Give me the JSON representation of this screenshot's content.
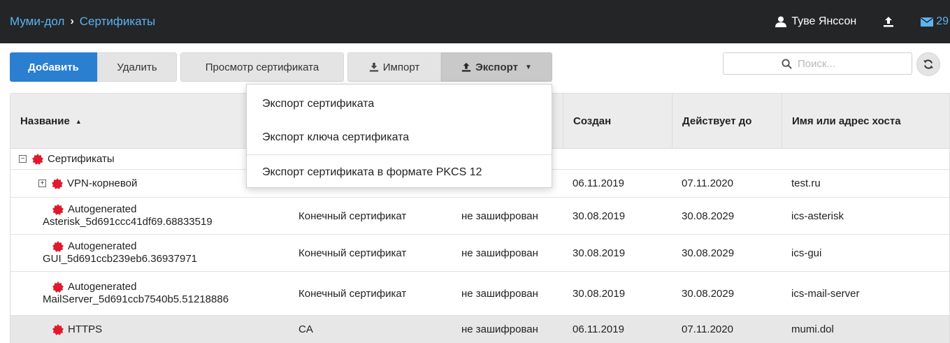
{
  "header": {
    "breadcrumb_root": "Муми-дол",
    "breadcrumb_separator": "›",
    "breadcrumb_current": "Сертификаты",
    "user_name": "Туве Янссон",
    "mail_count": "29"
  },
  "toolbar": {
    "add_label": "Добавить",
    "delete_label": "Удалить",
    "view_label": "Просмотр сертификата",
    "import_label": "Импорт",
    "export_label": "Экспорт"
  },
  "search": {
    "placeholder": "Поиск..."
  },
  "export_menu": {
    "items": [
      "Экспорт сертификата",
      "Экспорт ключа сертификата",
      "Экспорт сертификата в формате PKCS 12"
    ]
  },
  "table": {
    "columns": [
      "Название",
      "",
      "",
      "Создан",
      "Действует до",
      "Имя или адрес хоста"
    ],
    "rows": [
      {
        "name": "Сертификаты",
        "type": "",
        "key": "",
        "created": "",
        "expires": "",
        "host": ""
      },
      {
        "name": "VPN-корневой",
        "type": "",
        "key": "",
        "created": "06.11.2019",
        "expires": "07.11.2020",
        "host": "test.ru"
      },
      {
        "name_line1": "Autogenerated",
        "name_line2": "Asterisk_5d691ccc41df69.68833519",
        "type": "Конечный сертификат",
        "key": "не зашифрован",
        "created": "30.08.2019",
        "expires": "30.08.2029",
        "host": "ics-asterisk"
      },
      {
        "name_line1": "Autogenerated",
        "name_line2": "GUI_5d691ccb239eb6.36937971",
        "type": "Конечный сертификат",
        "key": "не зашифрован",
        "created": "30.08.2019",
        "expires": "30.08.2029",
        "host": "ics-gui"
      },
      {
        "name_line1": "Autogenerated",
        "name_line2": "MailServer_5d691ccb7540b5.51218886",
        "type": "Конечный сертификат",
        "key": "не зашифрован",
        "created": "30.08.2019",
        "expires": "30.08.2029",
        "host": "ics-mail-server"
      },
      {
        "name": "HTTPS",
        "type": "CA",
        "key": "не зашифрован",
        "created": "06.11.2019",
        "expires": "07.11.2020",
        "host": "mumi.dol"
      }
    ]
  },
  "colors": {
    "topbar_bg": "#232527",
    "link_blue": "#5db3f0",
    "primary_button": "#2a7fd0",
    "seal_red": "#e0192c"
  },
  "icons": {
    "user": "user-icon",
    "upload": "upload-icon",
    "mail": "envelope-icon",
    "import": "download-icon",
    "export": "upload-icon",
    "search": "search-icon",
    "refresh": "refresh-icon",
    "certificate": "certificate-seal-icon",
    "tree_expand": "tree-toggle-icon"
  }
}
